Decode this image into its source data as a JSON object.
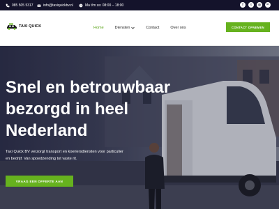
{
  "topbar": {
    "phone": "085 505 5317",
    "email": "info@taxiquickbv.nl",
    "hours": "Ma t/m za: 08:00 – 18:00",
    "socials": [
      {
        "icon": "facebook-icon",
        "glyph": "f"
      },
      {
        "icon": "twitter-icon",
        "glyph": "t"
      },
      {
        "icon": "instagram-icon",
        "glyph": "◎"
      },
      {
        "icon": "linkedin-icon",
        "glyph": "in"
      }
    ]
  },
  "header": {
    "logo_text": "TAXI QUICK",
    "nav": [
      {
        "label": "Home",
        "active": true
      },
      {
        "label": "Diensten",
        "active": false,
        "has_dropdown": true
      },
      {
        "label": "Contact",
        "active": false
      },
      {
        "label": "Over ons",
        "active": false
      }
    ],
    "cta": "CONTACT OPNEMEN"
  },
  "hero": {
    "title_lines": [
      "Snel en betrouwbaar",
      "bezorgd in heel",
      "Nederland"
    ],
    "subtitle_lines": [
      "Taxi Quick BV verzorgt transport en koeriersdiensten voor particulier",
      "en bedrijf. Van spoedzending tot vaste rit."
    ],
    "cta": "VRAAG EEN OFFERTE AAN"
  },
  "colors": {
    "accent": "#66b21e",
    "topbar_bg": "#14132b",
    "nav_active": "#5aa317"
  }
}
